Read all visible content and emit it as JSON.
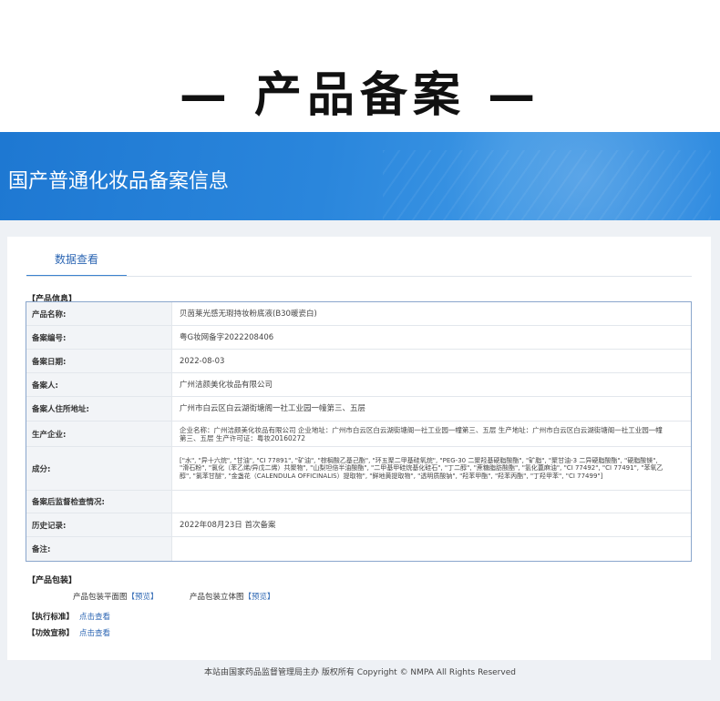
{
  "page_heading": "— 产品备案 —",
  "banner": {
    "title": "国产普通化妆品备案信息"
  },
  "tab": {
    "label": "数据查看"
  },
  "product_info": {
    "section_label": "【产品信息】",
    "rows": [
      {
        "label": "产品名称:",
        "value": "贝茵莱光感无瑕持妆粉底液(B30暖瓷白)"
      },
      {
        "label": "备案编号:",
        "value": "粤G妆网备字2022208406"
      },
      {
        "label": "备案日期:",
        "value": "2022-08-03"
      },
      {
        "label": "备案人:",
        "value": "广州洁颜美化妆品有限公司"
      },
      {
        "label": "备案人住所地址:",
        "value": "广州市白云区白云湖街塘阁一社工业园一幢第三、五层"
      },
      {
        "label": "生产企业:",
        "value": "企业名称：广州洁颜美化妆品有限公司 企业地址：广州市白云区白云湖街塘阁一社工业园一幢第三、五层 生产地址：广州市白云区白云湖街塘阁一社工业园一幢第三、五层 生产许可证：粤妆20160272"
      },
      {
        "label": "成分:",
        "value": "[\"水\", \"异十六烷\", \"甘油\", \"CI 77891\", \"矿油\", \"棕榈酸乙基己酯\", \"环五聚二甲基硅氧烷\", \"PEG-30 二聚羟基硬脂酸酯\", \"矿脂\", \"聚甘油-3 二异硬脂酸酯\", \"硬脂酸镁\", \"滑石粉\", \"氯化（苯乙烯/异戊二烯）共聚物\", \"山梨坦倍半油酸酯\", \"二甲基甲硅烷基化硅石\", \"丁二醇\", \"蔗糖脂肪酸酯\", \"氢化蓖麻油\", \"CI 77492\", \"CI 77491\", \"苯氧乙醇\", \"氯苯甘醚\", \"金盏花（CALENDULA OFFICINALIS）提取物\", \"鲜地黄提取物\", \"透明质酸钠\", \"羟苯甲酯\", \"羟苯丙酯\", \"丁羟甲苯\", \"CI 77499\"]"
      },
      {
        "label": "备案后监督检查情况:",
        "value": ""
      },
      {
        "label": "历史记录:",
        "value": "2022年08月23日 首次备案"
      },
      {
        "label": "备注:",
        "value": ""
      }
    ]
  },
  "packaging": {
    "section_label": "【产品包装】",
    "flat_label": "产品包装平面图",
    "flat_link": "【预览】",
    "solid_label": "产品包装立体图",
    "solid_link": "【预览】"
  },
  "standard": {
    "label": "【执行标准】",
    "link": "点击查看"
  },
  "efficacy": {
    "label": "【功效宣称】",
    "link": "点击查看"
  },
  "footer": "本站由国家药品监督管理局主办 版权所有 Copyright © NMPA All Rights Reserved",
  "colors": {
    "banner": "#2a86dc",
    "link": "#2c66b3",
    "table_border": "#8aa6cc"
  }
}
